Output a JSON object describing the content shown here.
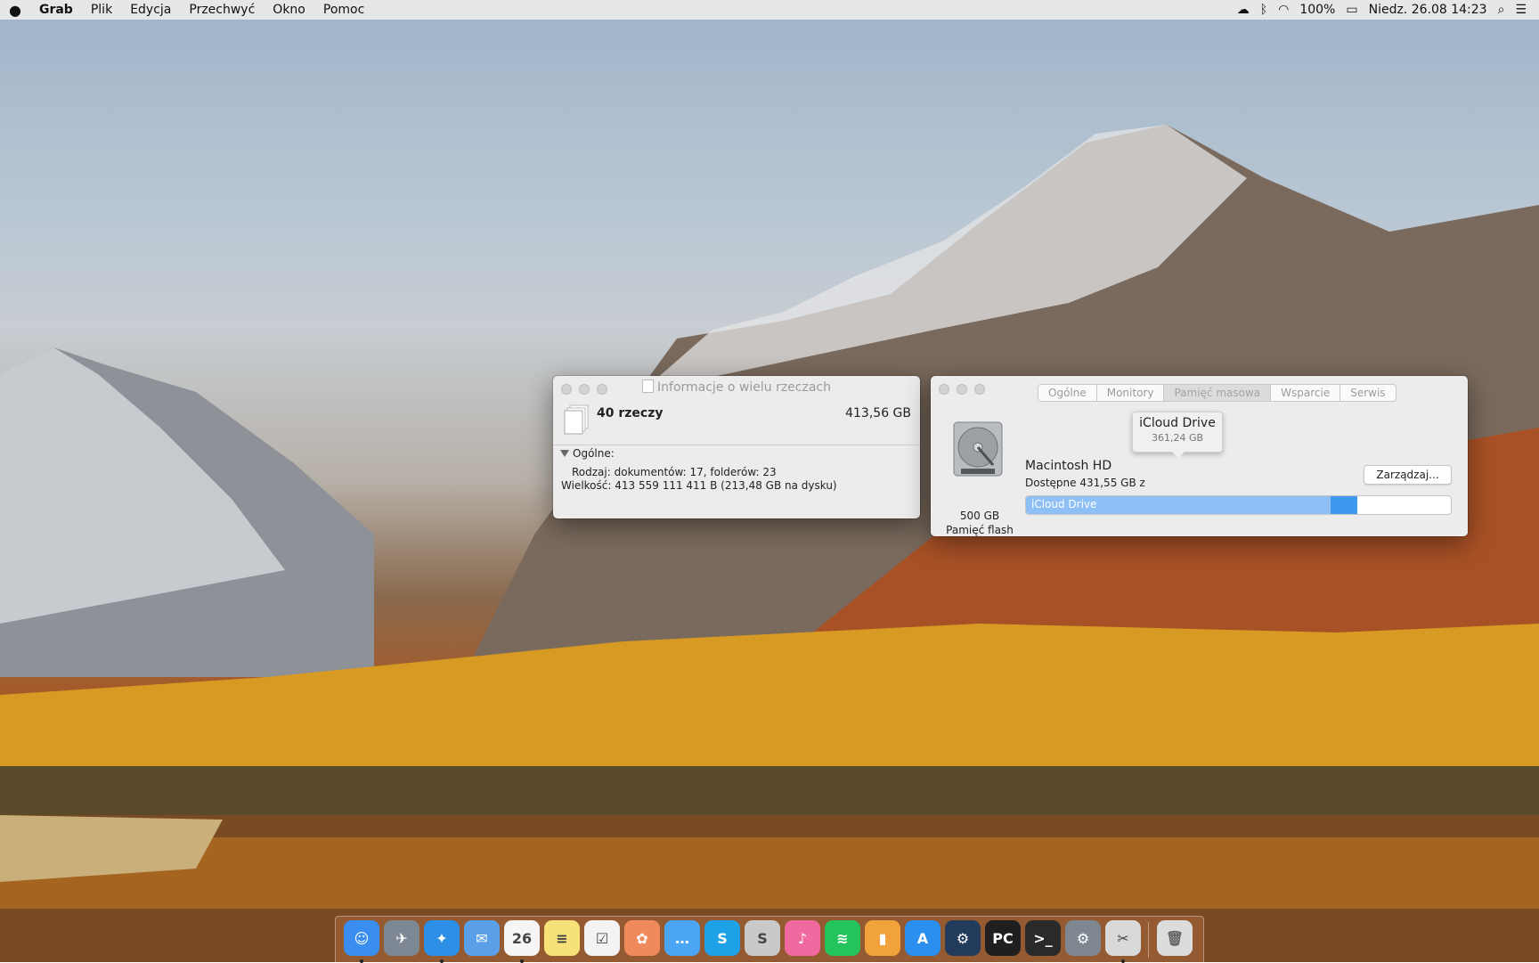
{
  "menubar": {
    "apple": "",
    "app_name": "Grab",
    "items": [
      "Plik",
      "Edycja",
      "Przechwyć",
      "Okno",
      "Pomoc"
    ],
    "battery": "100%",
    "datetime": "Niedz. 26.08  14:23",
    "status_icons": [
      "cloud-icon",
      "bluetooth-icon",
      "wifi-icon",
      "battery-icon",
      "search-icon",
      "list-icon"
    ]
  },
  "info_window": {
    "title": "Informacje o wielu rzeczach",
    "count": "40 rzeczy",
    "total_size": "413,56 GB",
    "section": "Ogólne:",
    "kind_label": "Rodzaj:",
    "kind_value": "dokumentów: 17, folderów: 23",
    "size_label": "Wielkość:",
    "size_value": "413 559 111 411 B (213,48 GB na dysku)"
  },
  "about_window": {
    "tabs": [
      "Ogólne",
      "Monitory",
      "Pamięć masowa",
      "Wsparcie",
      "Serwis"
    ],
    "selected_tab": "Pamięć masowa",
    "disk_capacity": "500 GB",
    "disk_kind": "Pamięć flash",
    "disk_name": "Macintosh HD",
    "available": "Dostępne 431,55 GB z",
    "bar_label": "iCloud Drive",
    "bar_fraction": 0.78,
    "manage_button": "Zarządzaj...",
    "tooltip_title": "iCloud Drive",
    "tooltip_value": "361,24 GB"
  },
  "dock": {
    "apps": [
      {
        "name": "finder-icon",
        "color": "#3a8ef0",
        "glyph": "☺"
      },
      {
        "name": "launchpad-icon",
        "color": "#7d8894",
        "glyph": "✈"
      },
      {
        "name": "safari-icon",
        "color": "#2d8fe6",
        "glyph": "✦"
      },
      {
        "name": "mail-icon",
        "color": "#5aa0e8",
        "glyph": "✉"
      },
      {
        "name": "calendar-icon",
        "color": "#f5f5f5",
        "glyph": "26"
      },
      {
        "name": "notes-icon",
        "color": "#f7e27a",
        "glyph": "≡"
      },
      {
        "name": "reminders-icon",
        "color": "#f3f3f3",
        "glyph": "☑"
      },
      {
        "name": "photos-icon",
        "color": "#f08a5d",
        "glyph": "✿"
      },
      {
        "name": "messages-icon",
        "color": "#4aa6f5",
        "glyph": "…"
      },
      {
        "name": "skype-icon",
        "color": "#1ea1e6",
        "glyph": "S"
      },
      {
        "name": "slides-icon",
        "color": "#c9c9c9",
        "glyph": "S"
      },
      {
        "name": "itunes-icon",
        "color": "#f06aa0",
        "glyph": "♪"
      },
      {
        "name": "spotify-icon",
        "color": "#23c45b",
        "glyph": "≋"
      },
      {
        "name": "ibooks-icon",
        "color": "#f2a23a",
        "glyph": "▮"
      },
      {
        "name": "app-store-icon",
        "color": "#2b8ff0",
        "glyph": "A"
      },
      {
        "name": "steam-icon",
        "color": "#243c5c",
        "glyph": "⚙"
      },
      {
        "name": "pycharm-icon",
        "color": "#1f1f1f",
        "glyph": "PC"
      },
      {
        "name": "terminal-icon",
        "color": "#2a2a2a",
        "glyph": ">_"
      },
      {
        "name": "system-preferences-icon",
        "color": "#7f8790",
        "glyph": "⚙"
      },
      {
        "name": "grab-icon",
        "color": "#d9d9d9",
        "glyph": "✂"
      }
    ],
    "trash": {
      "name": "trash-icon",
      "color": "#dcdcdc",
      "glyph": "🗑"
    }
  }
}
